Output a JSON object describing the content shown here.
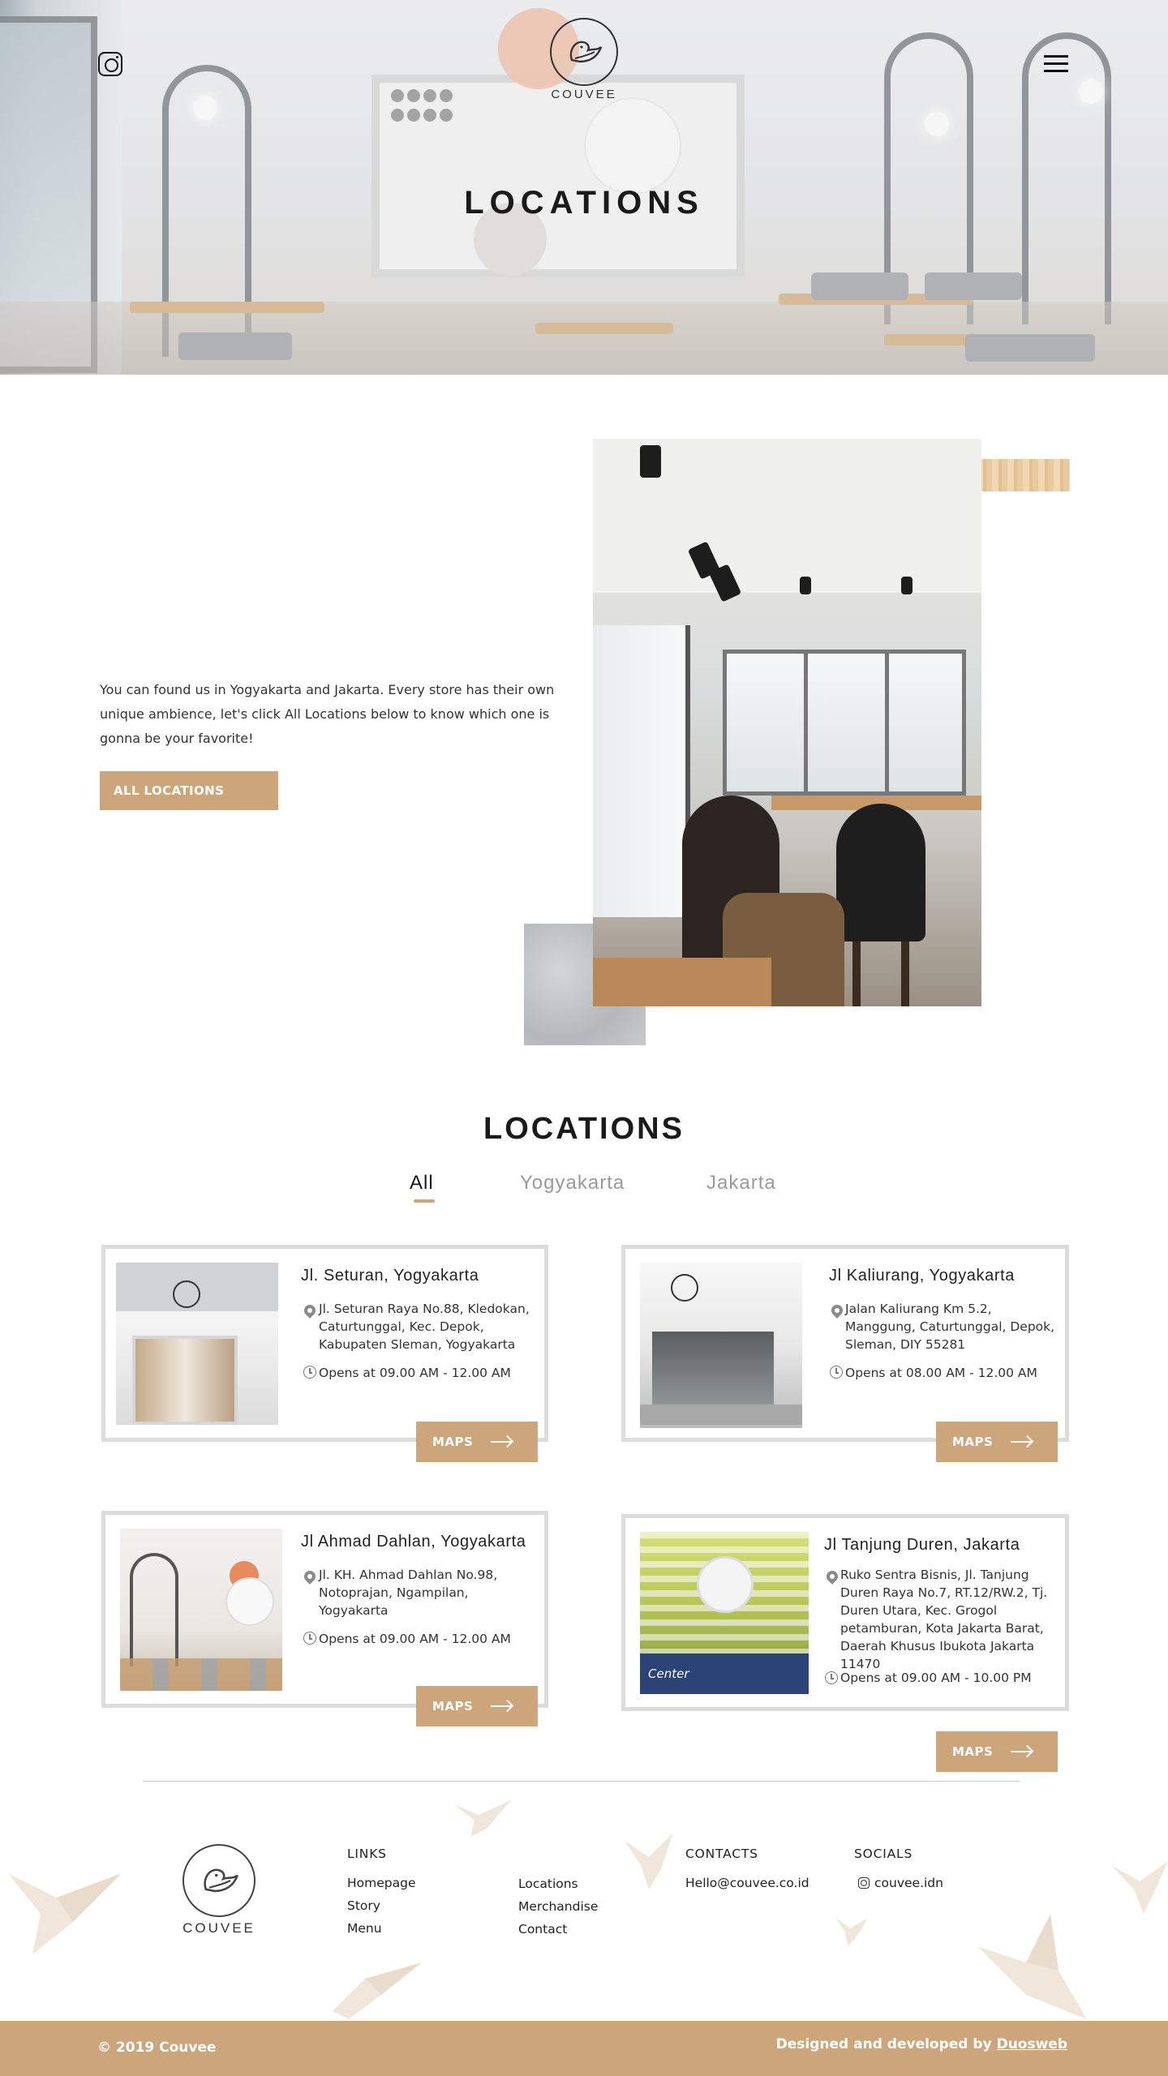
{
  "hero": {
    "title": "LOCATIONS",
    "logo_text": "COUVEE"
  },
  "intro": {
    "text": "You can found us in Yogyakarta and Jakarta. Every store has their own unique ambience, let's click All Locations below to know which one is gonna be your favorite!",
    "button_label": "ALL LOCATIONS"
  },
  "locations": {
    "title": "LOCATIONS",
    "tabs": [
      {
        "label": "All",
        "active": true
      },
      {
        "label": "Yogyakarta",
        "active": false
      },
      {
        "label": "Jakarta",
        "active": false
      }
    ],
    "cards": [
      {
        "name": "Jl. Seturan, Yogyakarta",
        "address": "Jl. Seturan Raya No.88, Kledokan, Caturtunggal, Kec. Depok, Kabupaten Sleman, Yogyakarta",
        "hours": "Opens at 09.00 AM - 12.00 AM",
        "button": "MAPS"
      },
      {
        "name": "Jl Kaliurang, Yogyakarta",
        "address": "Jalan Kaliurang Km 5.2, Manggung, Caturtunggal, Depok, Sleman, DIY 55281",
        "hours": "Opens at 08.00 AM - 12.00 AM",
        "button": "MAPS"
      },
      {
        "name": "Jl Ahmad Dahlan, Yogyakarta",
        "address": "Jl. KH. Ahmad Dahlan No.98, Notoprajan, Ngampilan, Yogyakarta",
        "hours": "Opens at 09.00 AM - 12.00 AM",
        "button": "MAPS"
      },
      {
        "name": "Jl Tanjung Duren, Jakarta",
        "address": "Ruko Sentra Bisnis, Jl. Tanjung Duren Raya No.7, RT.12/RW.2, Tj. Duren Utara, Kec. Grogol petamburan, Kota Jakarta Barat, Daerah Khusus Ibukota Jakarta 11470",
        "hours": "Opens at 09.00 AM - 10.00 PM",
        "button": "MAPS"
      }
    ]
  },
  "footer": {
    "logo_text": "COUVEE",
    "links_heading": "LINKS",
    "links_col1": [
      "Homepage",
      "Story",
      "Menu"
    ],
    "links_col2": [
      "Locations",
      "Merchandise",
      "Contact"
    ],
    "contacts_heading": "CONTACTS",
    "contact_email": "Hello@couvee.co.id",
    "socials_heading": "SOCIALS",
    "social_handle": "couvee.idn",
    "copyright": "© 2019 Couvee",
    "credit_prefix": "Designed and developed by ",
    "credit_link": "Duosweb"
  },
  "colors": {
    "accent": "#cda57a",
    "card_border": "#dcdcdc"
  }
}
